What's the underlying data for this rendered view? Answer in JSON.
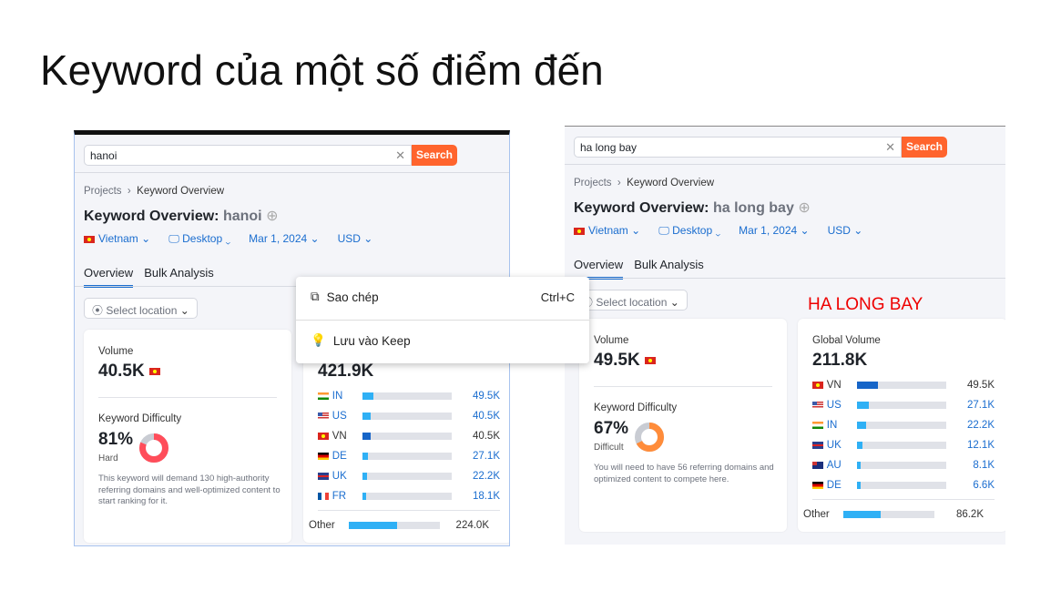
{
  "slide_title": "Keyword của một số điểm đến",
  "annotation": "HA LONG BAY",
  "context_menu": {
    "copy": "Sao chép",
    "copy_shortcut": "Ctrl+C",
    "keep": "Lưu vào Keep"
  },
  "panels": [
    {
      "search_value": "hanoi",
      "search_button": "Search",
      "breadcrumb": [
        "Projects",
        "Keyword Overview"
      ],
      "title_prefix": "Keyword Overview:",
      "keyword": "hanoi",
      "filters": {
        "country": "Vietnam",
        "device": "Desktop",
        "date": "Mar 1, 2024",
        "currency": "USD"
      },
      "tabs": [
        "Overview",
        "Bulk Analysis"
      ],
      "select_location": "Select location",
      "volume_label": "Volume",
      "volume": "40.5K",
      "kd_label": "Keyword Difficulty",
      "kd": "81%",
      "kd_percent": 81,
      "kd_level": "Hard",
      "kd_color": "#ff4d5a",
      "kd_desc": "This keyword will demand 130 high-authority referring domains and well-optimized content to start ranking for it.",
      "global_volume_label": "",
      "global_volume": "421.9K",
      "global_total": 421.9,
      "countries": [
        {
          "code": "IN",
          "flag": "in",
          "value": "49.5K",
          "num": 49.5
        },
        {
          "code": "US",
          "flag": "us",
          "value": "40.5K",
          "num": 40.5
        },
        {
          "code": "VN",
          "flag": "vn",
          "value": "40.5K",
          "num": 40.5,
          "home": true
        },
        {
          "code": "DE",
          "flag": "de",
          "value": "27.1K",
          "num": 27.1
        },
        {
          "code": "UK",
          "flag": "uk",
          "value": "22.2K",
          "num": 22.2
        },
        {
          "code": "FR",
          "flag": "fr",
          "value": "18.1K",
          "num": 18.1
        }
      ],
      "other_label": "Other",
      "other_value": "224.0K",
      "other_num": 224.0
    },
    {
      "search_value": "ha long bay",
      "search_button": "Search",
      "breadcrumb": [
        "Projects",
        "Keyword Overview"
      ],
      "title_prefix": "Keyword Overview:",
      "keyword": "ha long bay",
      "filters": {
        "country": "Vietnam",
        "device": "Desktop",
        "date": "Mar 1, 2024",
        "currency": "USD"
      },
      "tabs": [
        "Overview",
        "Bulk Analysis"
      ],
      "select_location": "Select location",
      "volume_label": "Volume",
      "volume": "49.5K",
      "kd_label": "Keyword Difficulty",
      "kd": "67%",
      "kd_percent": 67,
      "kd_level": "Difficult",
      "kd_color": "#ff8c3a",
      "kd_desc": "You will need to have 56 referring domains and optimized content to compete here.",
      "global_volume_label": "Global Volume",
      "global_volume": "211.8K",
      "global_total": 211.8,
      "countries": [
        {
          "code": "VN",
          "flag": "vn",
          "value": "49.5K",
          "num": 49.5,
          "home": true
        },
        {
          "code": "US",
          "flag": "us",
          "value": "27.1K",
          "num": 27.1
        },
        {
          "code": "IN",
          "flag": "in",
          "value": "22.2K",
          "num": 22.2
        },
        {
          "code": "UK",
          "flag": "uk",
          "value": "12.1K",
          "num": 12.1
        },
        {
          "code": "AU",
          "flag": "au",
          "value": "8.1K",
          "num": 8.1
        },
        {
          "code": "DE",
          "flag": "de",
          "value": "6.6K",
          "num": 6.6
        }
      ],
      "other_label": "Other",
      "other_value": "86.2K",
      "other_num": 86.2
    }
  ]
}
